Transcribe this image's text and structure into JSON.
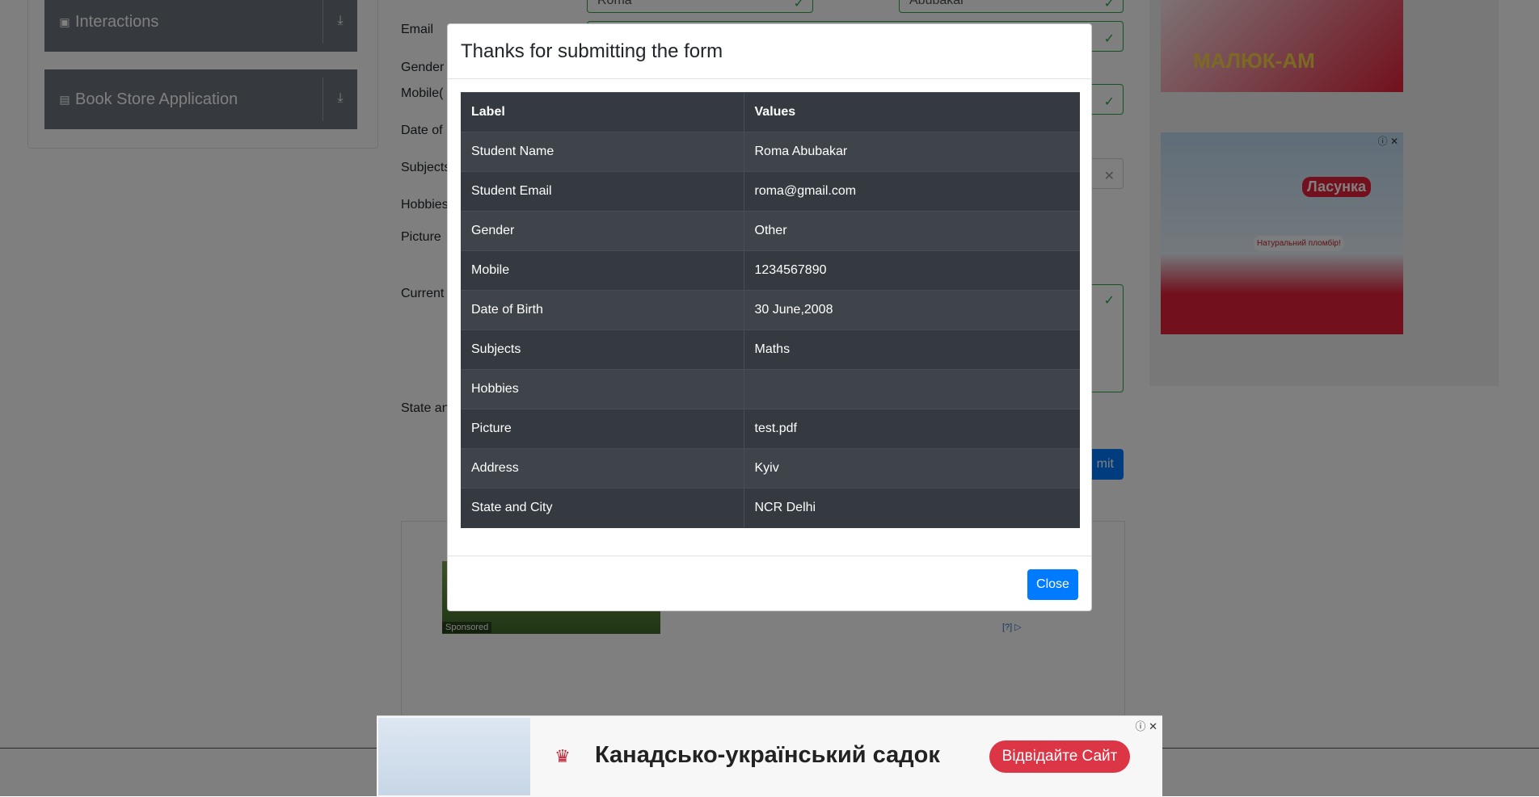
{
  "sidebar": {
    "groups": [
      {
        "label": "Interactions",
        "icon": "interactions-icon",
        "arrow": "download-icon"
      },
      {
        "label": "Book Store Application",
        "icon": "book-icon",
        "arrow": "download-icon"
      }
    ]
  },
  "form": {
    "labels": {
      "email": "Email",
      "gender": "Gender",
      "mobile": "Mobile(",
      "dob": "Date of",
      "subjects": "Subjects",
      "hobbies": "Hobbies",
      "picture": "Picture",
      "current_address": "Current",
      "state_city": "State an"
    },
    "first_name_value": "Roma",
    "last_name_value": "Abubakar",
    "submit_label": "mit"
  },
  "modal": {
    "title": "Thanks for submitting the form",
    "headers": [
      "Label",
      "Values"
    ],
    "rows": [
      {
        "label": "Student Name",
        "value": "Roma Abubakar"
      },
      {
        "label": "Student Email",
        "value": "roma@gmail.com"
      },
      {
        "label": "Gender",
        "value": "Other"
      },
      {
        "label": "Mobile",
        "value": "1234567890"
      },
      {
        "label": "Date of Birth",
        "value": "30 June,2008"
      },
      {
        "label": "Subjects",
        "value": "Maths"
      },
      {
        "label": "Hobbies",
        "value": ""
      },
      {
        "label": "Picture",
        "value": "test.pdf"
      },
      {
        "label": "Address",
        "value": "Kyiv"
      },
      {
        "label": "State and City",
        "value": "NCR Delhi"
      }
    ],
    "close_label": "Close"
  },
  "ads": {
    "sponsored_label": "Sponsored",
    "ad_marker": "[?]",
    "right_ad_1_text": "МАЛЮК-АМ",
    "right_ad_2_brand": "Ласунка",
    "right_ad_2_subtext": "Натуральний пломбір!",
    "bottom_headline": "Канадсько-український садок",
    "bottom_cta": "Відвідайте Сайт"
  },
  "colors": {
    "primary": "#007bff",
    "success": "#28a745",
    "table_dark": "#343a40",
    "table_stripe": "#3e444a",
    "ad_red": "#dc3545"
  }
}
